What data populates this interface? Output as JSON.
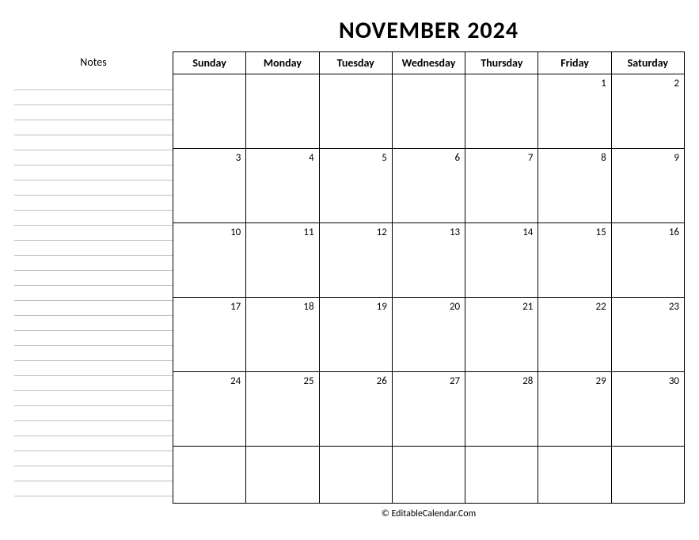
{
  "title": "NOVEMBER 2024",
  "notes_label": "Notes",
  "footer": "© EditableCalendar.Com",
  "days": [
    "Sunday",
    "Monday",
    "Tuesday",
    "Wednesday",
    "Thursday",
    "Friday",
    "Saturday"
  ],
  "note_line_count": 28,
  "weeks": [
    [
      {
        "num": "",
        "shaded": false
      },
      {
        "num": "",
        "shaded": false
      },
      {
        "num": "",
        "shaded": false
      },
      {
        "num": "",
        "shaded": false
      },
      {
        "num": "",
        "shaded": false
      },
      {
        "num": "1",
        "shaded": false
      },
      {
        "num": "2",
        "shaded": true
      }
    ],
    [
      {
        "num": "3",
        "shaded": true
      },
      {
        "num": "4",
        "shaded": false
      },
      {
        "num": "5",
        "shaded": false
      },
      {
        "num": "6",
        "shaded": false
      },
      {
        "num": "7",
        "shaded": false
      },
      {
        "num": "8",
        "shaded": false
      },
      {
        "num": "9",
        "shaded": true
      }
    ],
    [
      {
        "num": "10",
        "shaded": true
      },
      {
        "num": "11",
        "shaded": false
      },
      {
        "num": "12",
        "shaded": false
      },
      {
        "num": "13",
        "shaded": false
      },
      {
        "num": "14",
        "shaded": false
      },
      {
        "num": "15",
        "shaded": false
      },
      {
        "num": "16",
        "shaded": true
      }
    ],
    [
      {
        "num": "17",
        "shaded": true
      },
      {
        "num": "18",
        "shaded": false
      },
      {
        "num": "19",
        "shaded": false
      },
      {
        "num": "20",
        "shaded": false
      },
      {
        "num": "21",
        "shaded": false
      },
      {
        "num": "22",
        "shaded": false
      },
      {
        "num": "23",
        "shaded": true
      }
    ],
    [
      {
        "num": "24",
        "shaded": true
      },
      {
        "num": "25",
        "shaded": false
      },
      {
        "num": "26",
        "shaded": false
      },
      {
        "num": "27",
        "shaded": false
      },
      {
        "num": "28",
        "shaded": false
      },
      {
        "num": "29",
        "shaded": false
      },
      {
        "num": "30",
        "shaded": true
      }
    ],
    [
      {
        "num": "",
        "shaded": false
      },
      {
        "num": "",
        "shaded": false
      },
      {
        "num": "",
        "shaded": false
      },
      {
        "num": "",
        "shaded": false
      },
      {
        "num": "",
        "shaded": false
      },
      {
        "num": "",
        "shaded": false
      },
      {
        "num": "",
        "shaded": false
      }
    ]
  ]
}
